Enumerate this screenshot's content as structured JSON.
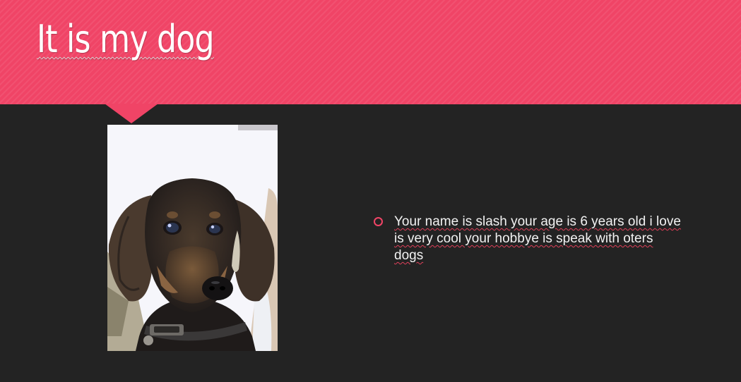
{
  "slide": {
    "title": "It is my dog",
    "bullets": [
      {
        "text": "Your name is slash your age is 6 years old i love is very cool your hobbye is speak with oters dogs"
      }
    ]
  },
  "colors": {
    "accent": "#f04466",
    "background": "#232323",
    "text": "#f2f2f2"
  },
  "photo": {
    "subject": "dachshund puppy with collar"
  }
}
